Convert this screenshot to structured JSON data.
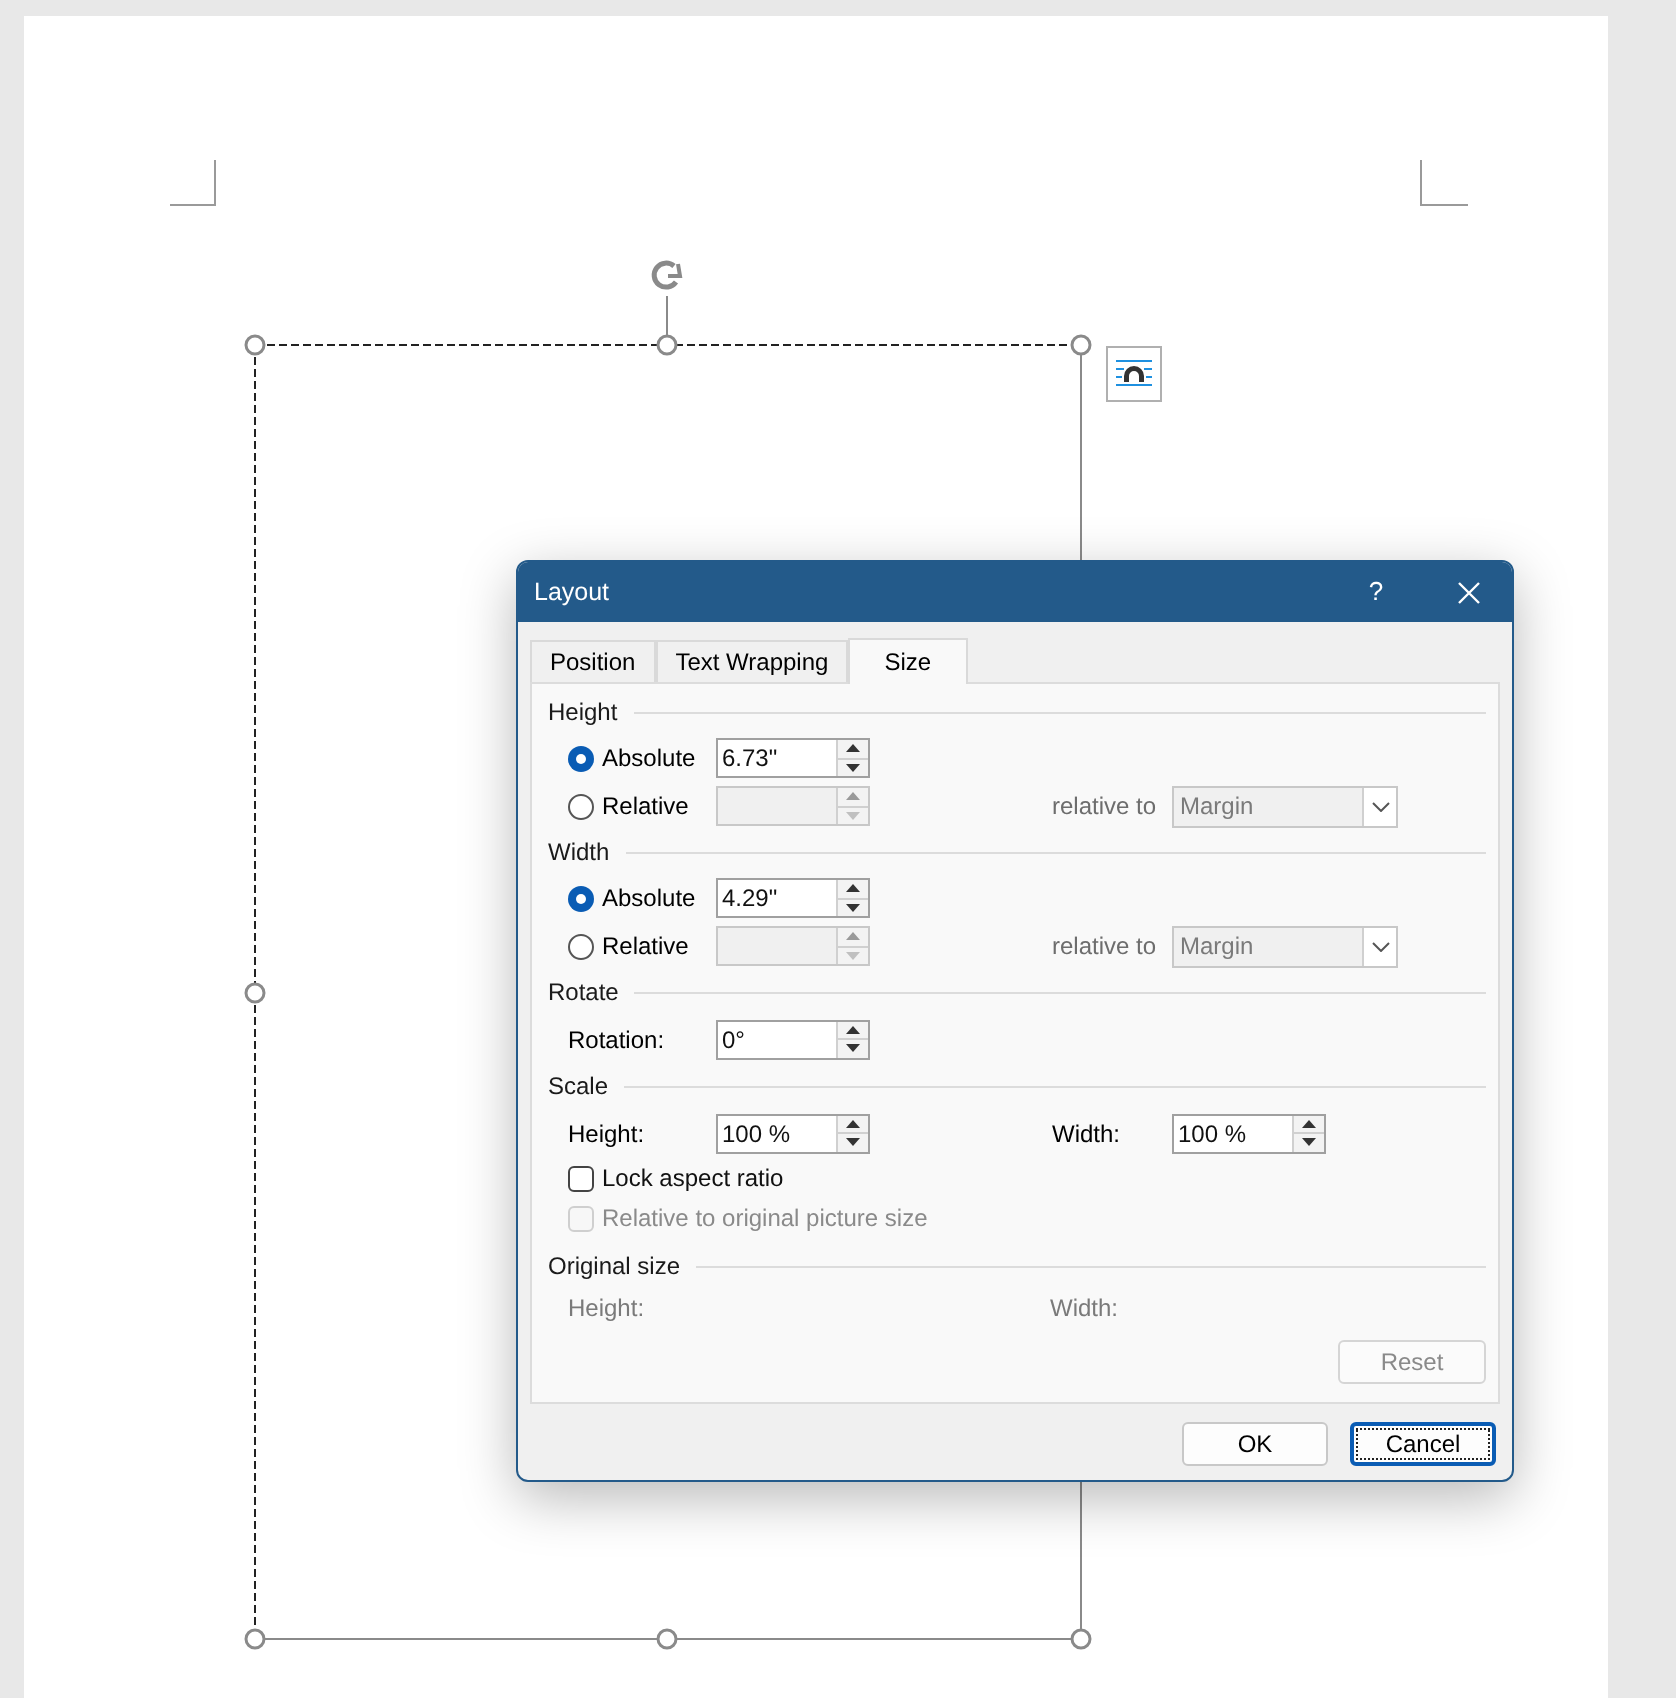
{
  "dialog": {
    "title": "Layout",
    "help": "?",
    "tabs": [
      {
        "label": "Position",
        "selected": false
      },
      {
        "label": "Text Wrapping",
        "selected": false
      },
      {
        "label": "Size",
        "selected": true
      }
    ],
    "sections": [
      {
        "heading": "Height",
        "options": [
          {
            "label": "Absolute",
            "selected": true,
            "disabled": false,
            "value": "6.73\""
          },
          {
            "label": "Relative",
            "selected": false,
            "disabled": true,
            "relative_to": "relative to",
            "dropdown": "Margin"
          }
        ]
      },
      {
        "heading": "Width",
        "options": [
          {
            "label": "Absolute",
            "selected": true,
            "disabled": false,
            "value": "4.29\""
          },
          {
            "label": "Relative",
            "selected": false,
            "disabled": true,
            "relative_to": "relative to",
            "dropdown": "Margin"
          }
        ]
      }
    ],
    "rotate": {
      "heading": "Rotate",
      "label": "Rotation:",
      "value": "0°"
    },
    "scale": {
      "heading": "Scale",
      "height_label": "Height:",
      "height_value": "100 %",
      "width_label": "Width:",
      "width_value": "100 %",
      "checkboxes": [
        {
          "label": "Lock aspect ratio",
          "checked": false,
          "disabled": false
        },
        {
          "label": "Relative to original picture size",
          "checked": false,
          "disabled": true
        }
      ]
    },
    "original_size": {
      "heading": "Original size",
      "height_label": "Height:",
      "width_label": "Width:"
    },
    "reset": {
      "label": "Reset",
      "disabled": true
    },
    "buttons": [
      {
        "label": "OK",
        "focused": false
      },
      {
        "label": "Cancel",
        "focused": true
      }
    ]
  }
}
